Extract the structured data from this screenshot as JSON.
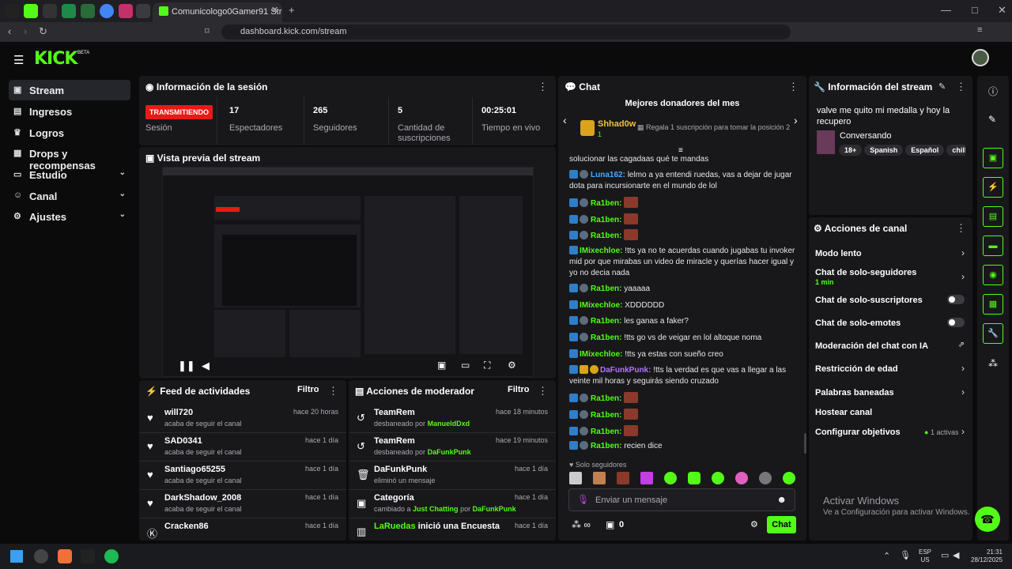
{
  "browser": {
    "tab_title": "Comunicologo0Gamer91 Stream",
    "url": "dashboard.kick.com/stream"
  },
  "brand": {
    "logo": "KICK",
    "badge": "BETA",
    "accent": "#53fc18"
  },
  "sidebar": {
    "items": [
      {
        "label": "Stream",
        "icon": "broadcast-icon",
        "active": true
      },
      {
        "label": "Ingresos",
        "icon": "money-icon"
      },
      {
        "label": "Logros",
        "icon": "trophy-icon"
      },
      {
        "label": "Drops y recompensas",
        "icon": "gift-icon"
      },
      {
        "label": "Estudio",
        "icon": "studio-icon",
        "expandable": true
      },
      {
        "label": "Canal",
        "icon": "people-icon",
        "expandable": true
      },
      {
        "label": "Ajustes",
        "icon": "gear-icon",
        "expandable": true
      }
    ]
  },
  "session": {
    "title": "Información de la sesión",
    "live_badge": "TRANSMITIENDO",
    "live_label": "Sesión",
    "stats": [
      {
        "value": "17",
        "label": "Espectadores"
      },
      {
        "value": "265",
        "label": "Seguidores"
      },
      {
        "value": "5",
        "label": "Cantidad de suscripciones"
      },
      {
        "value": "00:25:01",
        "label": "Tiempo en vivo"
      }
    ]
  },
  "preview": {
    "title": "Vista previa del stream"
  },
  "activity_feed": {
    "title": "Feed de actividades",
    "filter": "Filtro",
    "rows": [
      {
        "name": "will720",
        "sub": "acaba de seguir el canal",
        "time": "hace 20 horas"
      },
      {
        "name": "SAD0341",
        "sub": "acaba de seguir el canal",
        "time": "hace 1 día"
      },
      {
        "name": "Santiago65255",
        "sub": "acaba de seguir el canal",
        "time": "hace 1 día"
      },
      {
        "name": "DarkShadow_2008",
        "sub": "acaba de seguir el canal",
        "time": "hace 1 día"
      },
      {
        "name": "Cracken86",
        "sub": "",
        "time": "hace 1 día"
      }
    ]
  },
  "mod_actions": {
    "title": "Acciones de moderador",
    "filter": "Filtro",
    "rows": [
      {
        "name": "TeamRem",
        "sub": "desbaneado por",
        "by": "ManueldDxd",
        "time": "hace 18 minutos"
      },
      {
        "name": "TeamRem",
        "sub": "desbaneado por",
        "by": "DaFunkPunk",
        "time": "hace 19 minutos"
      },
      {
        "name": "DaFunkPunk",
        "sub": "eliminó un mensaje",
        "by": "",
        "time": "hace 1 día"
      },
      {
        "name": "Categoría",
        "sub": "cambiado a",
        "target": "Just Chatting",
        "by_word": "por",
        "by": "DaFunkPunk",
        "time": "hace 1 día"
      },
      {
        "name": "LaRuedas",
        "name_suffix": "inició una Encuesta",
        "sub": "",
        "by": "",
        "time": "hace 1 día"
      }
    ]
  },
  "chat": {
    "title": "Chat",
    "donors_title": "Mejores donadores del mes",
    "donor_name": "Shhad0w",
    "donor_count": "1",
    "donor_cta": "Regala 1 suscripción para tomar la posición 2",
    "messages": [
      {
        "user": "",
        "text": "solucionar las cagadaas qué te mandas"
      },
      {
        "user": "Luna162",
        "text": "lelmo a ya entendi ruedas, vas a dejar de jugar dota para incursionarte en el mundo de lol"
      },
      {
        "user": "Ra1ben",
        "text": ""
      },
      {
        "user": "Ra1ben",
        "text": ""
      },
      {
        "user": "Ra1ben",
        "text": ""
      },
      {
        "user": "IMixechloe",
        "text": "!tts ya no te acuerdas cuando jugabas tu invoker mid por que mirabas un video de miracle y querías hacer igual y yo no decia nada"
      },
      {
        "user": "Ra1ben",
        "text": "yaaaaa"
      },
      {
        "user": "IMixechloe",
        "text": "XDDDDDD"
      },
      {
        "user": "Ra1ben",
        "text": "les ganas a faker?"
      },
      {
        "user": "Ra1ben",
        "text": "!tts go vs de veigar en lol altoque noma"
      },
      {
        "user": "IMixechloe",
        "text": "!tts ya estas con sueño creo"
      },
      {
        "user": "DaFunkPunk",
        "text": "!tts la verdad es que vas a llegar a las veinte mil horas y seguirás siendo cruzado"
      },
      {
        "user": "Ra1ben",
        "text": ""
      },
      {
        "user": "Ra1ben",
        "text": ""
      },
      {
        "user": "Ra1ben",
        "text": ""
      },
      {
        "user": "Ra1ben",
        "text": "recien dice"
      }
    ],
    "followers_only": "Solo seguidores",
    "input_placeholder": "Enviar un mensaje",
    "viewer_count": "0",
    "send": "Chat"
  },
  "stream_info": {
    "title": "Información del stream",
    "stream_title": "valve me quito mi medalla y hoy la recupero",
    "category": "Conversando",
    "tags": [
      "18+",
      "Spanish",
      "Español",
      "chill"
    ]
  },
  "channel_actions": {
    "title": "Acciones de canal",
    "rows": [
      {
        "label": "Modo lento",
        "control": "chevron"
      },
      {
        "label": "Chat de solo-seguidores",
        "sub": "1 min",
        "control": "chevron"
      },
      {
        "label": "Chat de solo-suscriptores",
        "control": "toggle"
      },
      {
        "label": "Chat de solo-emotes",
        "control": "toggle"
      },
      {
        "label": "Moderación del chat con IA",
        "control": "external"
      },
      {
        "label": "Restricción de edad",
        "control": "chevron"
      },
      {
        "label": "Palabras baneadas",
        "control": "chevron"
      },
      {
        "label": "Hostear canal",
        "control": "none"
      },
      {
        "label": "Configurar objetivos",
        "status": "1 activas",
        "control": "chevron"
      }
    ]
  },
  "watermark": {
    "line1": "Activar Windows",
    "line2": "Ve a Configuración para activar Windows."
  },
  "taskbar": {
    "lang": "ESP",
    "region": "US",
    "time": "21:31",
    "date": "28/12/2025"
  }
}
